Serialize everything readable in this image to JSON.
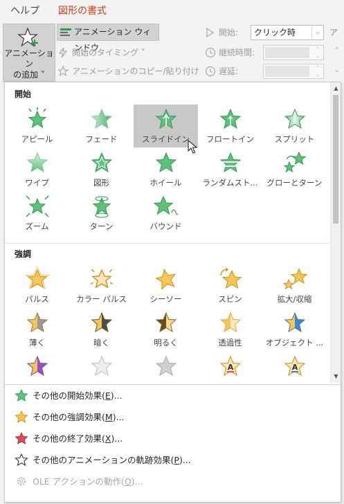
{
  "tabs": {
    "help": "ヘルプ",
    "shape_format": "図形の書式"
  },
  "ribbon": {
    "add_animation_line1": "アニメーション",
    "add_animation_line2": "の追加 ˅",
    "animation_window": "アニメーション ウィンドウ",
    "trigger": "開始のタイミング ˅",
    "animation_painter": "アニメーションのコピー/貼り付け",
    "start_label": "開始:",
    "start_value": "クリック時",
    "duration_label": "継続時間:",
    "delay_label": "遅延:",
    "right_cut": "ア"
  },
  "sections": {
    "entrance": "開始",
    "emphasis": "強調"
  },
  "entrance_effects": [
    {
      "label": "アピール"
    },
    {
      "label": "フェード"
    },
    {
      "label": "スライドイン"
    },
    {
      "label": "フロートイン"
    },
    {
      "label": "スプリット"
    },
    {
      "label": "ワイプ"
    },
    {
      "label": "図形"
    },
    {
      "label": "ホイール"
    },
    {
      "label": "ランダムスト..."
    },
    {
      "label": "グローとターン"
    },
    {
      "label": "ズーム"
    },
    {
      "label": "ターン"
    },
    {
      "label": "バウンド"
    }
  ],
  "emphasis_effects": [
    {
      "label": "パルス"
    },
    {
      "label": "カラー パルス"
    },
    {
      "label": "シーソー"
    },
    {
      "label": "スピン"
    },
    {
      "label": "拡大/収縮"
    },
    {
      "label": "薄く"
    },
    {
      "label": "暗く"
    },
    {
      "label": "明るく"
    },
    {
      "label": "透過性"
    },
    {
      "label": "オブジェクト ..."
    }
  ],
  "more_effects": [
    {
      "prefix": "その他の開始効果(",
      "key": "E",
      "suffix": ")..."
    },
    {
      "prefix": "その他の強調効果(",
      "key": "M",
      "suffix": ")..."
    },
    {
      "prefix": "その他の終了効果(",
      "key": "X",
      "suffix": ")..."
    },
    {
      "prefix": "その他のアニメーションの軌跡効果(",
      "key": "P",
      "suffix": ")..."
    },
    {
      "prefix": "OLE アクションの動作(",
      "key": "O",
      "suffix": ")..."
    }
  ],
  "colors": {
    "entrance_green": "#5fbf7b",
    "emphasis_gold": "#f2b233",
    "exit_red": "#e0485a",
    "selected_bg": "#c8c8c8",
    "accent_tab": "#c43e1c"
  }
}
